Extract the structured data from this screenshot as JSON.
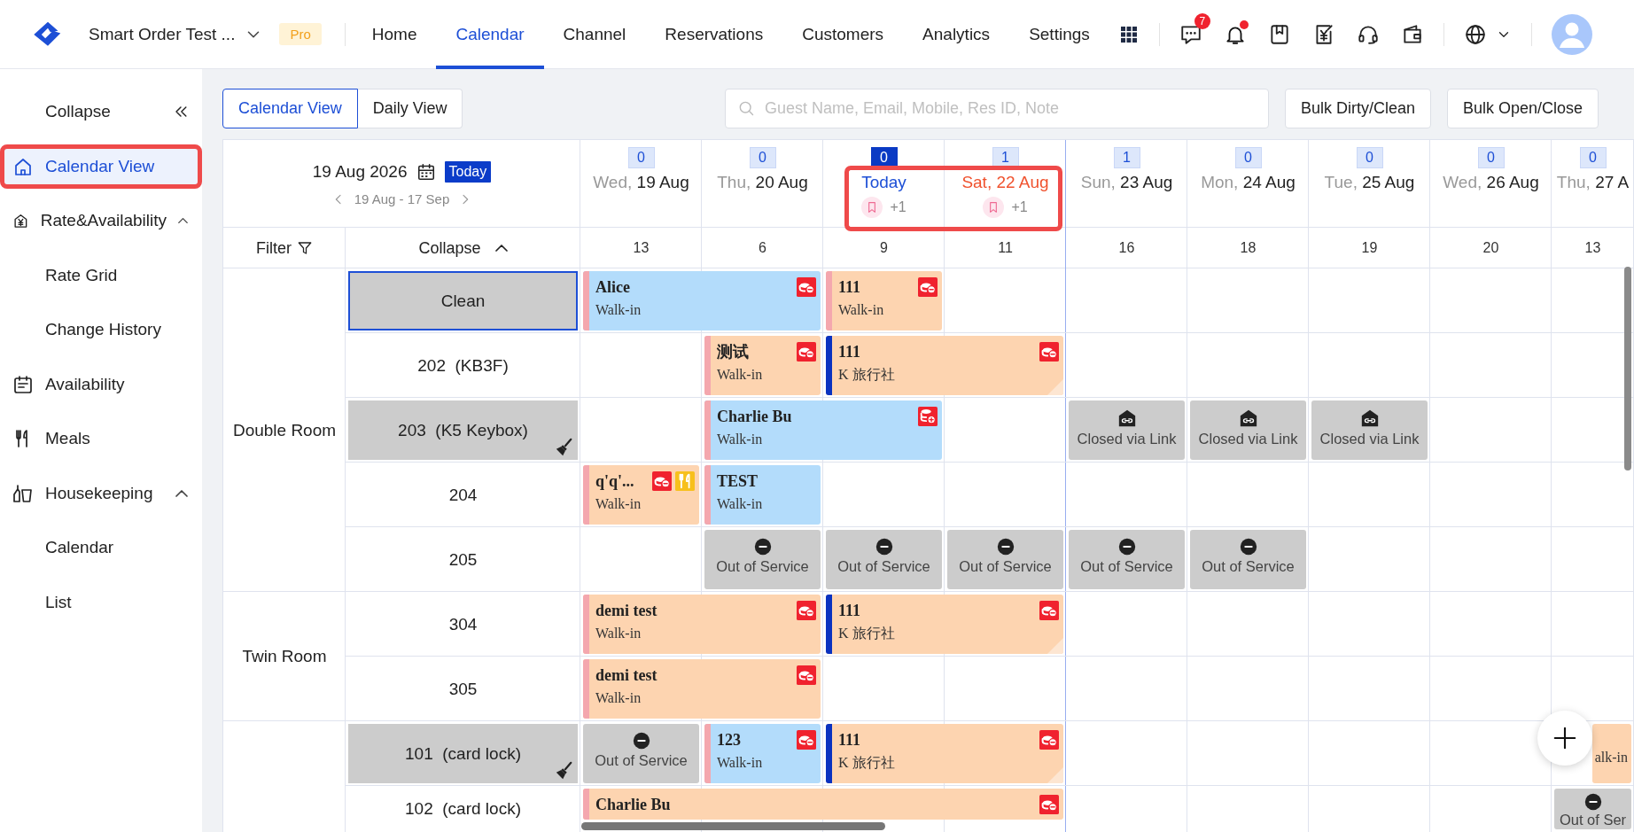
{
  "header": {
    "workspace": "Smart Order Test ...",
    "plan": "Pro",
    "nav": [
      {
        "label": "Home",
        "selected": false
      },
      {
        "label": "Calendar",
        "selected": true
      },
      {
        "label": "Channel",
        "selected": false
      },
      {
        "label": "Reservations",
        "selected": false
      },
      {
        "label": "Customers",
        "selected": false
      },
      {
        "label": "Analytics",
        "selected": false
      },
      {
        "label": "Settings",
        "selected": false
      }
    ],
    "tools": [
      {
        "badge": "7",
        "dot": false
      },
      {
        "dot": true
      },
      {
        "dot": false
      },
      {
        "dot": false
      },
      {
        "dot": false
      },
      {
        "dot": false
      }
    ]
  },
  "sidebar": {
    "collapse": "Collapse",
    "items": [
      {
        "label": "Calendar View",
        "selected": true,
        "highlighted": true
      },
      {
        "label": "Rate&Availability",
        "selected": false,
        "highlighted": false,
        "expanded": true,
        "children": [
          {
            "label": "Rate Grid",
            "selected": false
          },
          {
            "label": "Change History",
            "selected": false
          }
        ]
      },
      {
        "label": "Availability",
        "selected": false,
        "highlighted": false
      },
      {
        "label": "Meals",
        "selected": false,
        "highlighted": false
      },
      {
        "label": "Housekeeping",
        "selected": false,
        "highlighted": false,
        "expanded": true,
        "children": [
          {
            "label": "Calendar",
            "selected": false
          },
          {
            "label": "List",
            "selected": false
          }
        ]
      }
    ]
  },
  "toolbar": {
    "views": [
      {
        "label": "Calendar View",
        "selected": true
      },
      {
        "label": "Daily View",
        "selected": false
      }
    ],
    "search": {
      "placeholder": "Guest Name, Email, Mobile, Res ID, Note"
    },
    "buttons": [
      "Bulk Dirty/Clean",
      "Bulk Open/Close"
    ]
  },
  "calendar": {
    "current_date": "19 Aug 2026",
    "today_button": "Today",
    "range": "19 Aug - 17 Sep",
    "filter": "Filter",
    "collapse": "Collapse",
    "dates": [
      {
        "kind": "weekday",
        "weekday": "Wed,",
        "date": "19 Aug",
        "count": "0",
        "selected": false,
        "highlighted": false,
        "boundary": false,
        "occupancy": "13"
      },
      {
        "kind": "weekday",
        "weekday": "Thu,",
        "date": "20 Aug",
        "count": "0",
        "selected": false,
        "highlighted": false,
        "boundary": false,
        "occupancy": "6"
      },
      {
        "kind": "today",
        "date": "Today",
        "note": "+1",
        "count": "0",
        "selected": true,
        "highlighted": true,
        "boundary": false,
        "occupancy": "9"
      },
      {
        "kind": "weekend",
        "date": "Sat, 22 Aug",
        "note": "+1",
        "count": "1",
        "selected": false,
        "highlighted": true,
        "boundary": true,
        "occupancy": "11"
      },
      {
        "kind": "weekday",
        "weekday": "Sun,",
        "date": "23 Aug",
        "count": "1",
        "selected": false,
        "highlighted": false,
        "boundary": false,
        "occupancy": "16"
      },
      {
        "kind": "weekday",
        "weekday": "Mon,",
        "date": "24 Aug",
        "count": "0",
        "selected": false,
        "highlighted": false,
        "boundary": false,
        "occupancy": "18"
      },
      {
        "kind": "weekday",
        "weekday": "Tue,",
        "date": "25 Aug",
        "count": "0",
        "selected": false,
        "highlighted": false,
        "boundary": false,
        "occupancy": "19"
      },
      {
        "kind": "weekday",
        "weekday": "Wed,",
        "date": "26 Aug",
        "count": "0",
        "selected": false,
        "highlighted": false,
        "boundary": false,
        "occupancy": "20"
      },
      {
        "kind": "weekday",
        "weekday": "Thu,",
        "date": "27 A",
        "count": "0",
        "selected": false,
        "highlighted": false,
        "boundary": false,
        "occupancy": "13"
      }
    ],
    "groups": [
      {
        "room_type": "Double Room",
        "rooms": [
          {
            "label": "Clean",
            "dirty": true,
            "selected": true,
            "cells": [
              {
                "kind": "booking",
                "name": "Alice",
                "source": "Walk-in",
                "color": "#b3dcfb",
                "stripe": {
                  "color": "#f4a7ae"
                },
                "icons": [
                  {
                    "kind": "unpaid"
                  }
                ],
                "folded": false
              },
              {
                "kind": "continues"
              },
              {
                "kind": "booking",
                "name": "111",
                "source": "Walk-in",
                "color": "#fdd4b0",
                "stripe": {
                  "color": "#f4a7ae"
                },
                "icons": [
                  {
                    "kind": "unpaid"
                  }
                ],
                "folded": false
              },
              {
                "kind": "empty"
              },
              {
                "kind": "empty"
              },
              {
                "kind": "empty"
              },
              {
                "kind": "empty"
              },
              {
                "kind": "empty"
              },
              {
                "kind": "empty"
              }
            ]
          },
          {
            "label": "202  (KB3F)",
            "dirty": false,
            "selected": false,
            "cells": [
              {
                "kind": "empty"
              },
              {
                "kind": "booking",
                "name": "测试",
                "source": "Walk-in",
                "color": "#fdd4b0",
                "stripe": {
                  "color": "#f4a7ae"
                },
                "icons": [
                  {
                    "kind": "unpaid"
                  }
                ],
                "folded": false
              },
              {
                "kind": "booking",
                "name": "111",
                "source": "K 旅行社",
                "color": "#fdd4b0",
                "stripe": {
                  "color": "#0a32c0"
                },
                "icons": [
                  {
                    "kind": "unpaid"
                  }
                ],
                "folded": true
              },
              {
                "kind": "continues"
              },
              {
                "kind": "empty"
              },
              {
                "kind": "empty"
              },
              {
                "kind": "empty"
              },
              {
                "kind": "empty"
              },
              {
                "kind": "empty"
              }
            ]
          },
          {
            "label": "203  (K5 Keybox)",
            "dirty": true,
            "selected": false,
            "cells": [
              {
                "kind": "empty"
              },
              {
                "kind": "booking",
                "name": "Charlie Bu",
                "source": "Walk-in",
                "color": "#b3dcfb",
                "stripe": {
                  "color": "#f4a7ae"
                },
                "icons": [
                  {
                    "kind": "deposit"
                  }
                ],
                "folded": false
              },
              {
                "kind": "continues"
              },
              {
                "kind": "empty"
              },
              {
                "kind": "closed-link",
                "label": "Closed via Link"
              },
              {
                "kind": "closed-link",
                "label": "Closed via Link"
              },
              {
                "kind": "closed-link",
                "label": "Closed via Link"
              },
              {
                "kind": "empty"
              },
              {
                "kind": "empty"
              }
            ]
          },
          {
            "label": "204",
            "dirty": false,
            "selected": false,
            "cells": [
              {
                "kind": "booking",
                "name": "q'q'...",
                "source": "Walk-in",
                "color": "#fdd4b0",
                "stripe": {
                  "color": "#f4a7ae"
                },
                "icons": [
                  {
                    "kind": "unpaid"
                  },
                  {
                    "kind": "meal"
                  }
                ],
                "folded": false
              },
              {
                "kind": "booking",
                "name": "TEST",
                "source": "Walk-in",
                "color": "#b3dcfb",
                "stripe": {
                  "color": "#f4a7ae"
                },
                "folded": false
              },
              {
                "kind": "empty"
              },
              {
                "kind": "empty"
              },
              {
                "kind": "empty"
              },
              {
                "kind": "empty"
              },
              {
                "kind": "empty"
              },
              {
                "kind": "empty"
              },
              {
                "kind": "empty"
              }
            ]
          },
          {
            "label": "205",
            "dirty": false,
            "selected": false,
            "cells": [
              {
                "kind": "empty"
              },
              {
                "kind": "out-of-service",
                "label": "Out of Service"
              },
              {
                "kind": "out-of-service",
                "label": "Out of Service"
              },
              {
                "kind": "out-of-service",
                "label": "Out of Service"
              },
              {
                "kind": "out-of-service",
                "label": "Out of Service"
              },
              {
                "kind": "out-of-service",
                "label": "Out of Service"
              },
              {
                "kind": "empty"
              },
              {
                "kind": "empty"
              },
              {
                "kind": "empty"
              }
            ]
          }
        ]
      },
      {
        "room_type": "Twin Room",
        "rooms": [
          {
            "label": "304",
            "dirty": false,
            "selected": false,
            "cells": [
              {
                "kind": "booking",
                "name": "demi test",
                "source": "Walk-in",
                "color": "#fdd4b0",
                "stripe": {
                  "color": "#f4a7ae"
                },
                "icons": [
                  {
                    "kind": "unpaid"
                  }
                ],
                "folded": false
              },
              {
                "kind": "continues"
              },
              {
                "kind": "booking",
                "name": "111",
                "source": "K 旅行社",
                "color": "#fdd4b0",
                "stripe": {
                  "color": "#0a32c0"
                },
                "icons": [
                  {
                    "kind": "unpaid"
                  }
                ],
                "folded": true
              },
              {
                "kind": "continues"
              },
              {
                "kind": "empty"
              },
              {
                "kind": "empty"
              },
              {
                "kind": "empty"
              },
              {
                "kind": "empty"
              },
              {
                "kind": "empty"
              }
            ]
          },
          {
            "label": "305",
            "dirty": false,
            "selected": false,
            "cells": [
              {
                "kind": "booking",
                "name": "demi test",
                "source": "Walk-in",
                "color": "#fdd4b0",
                "stripe": {
                  "color": "#f4a7ae"
                },
                "icons": [
                  {
                    "kind": "unpaid"
                  }
                ],
                "folded": false
              },
              {
                "kind": "continues"
              },
              {
                "kind": "empty"
              },
              {
                "kind": "empty"
              },
              {
                "kind": "empty"
              },
              {
                "kind": "empty"
              },
              {
                "kind": "empty"
              },
              {
                "kind": "empty"
              },
              {
                "kind": "empty"
              }
            ]
          }
        ]
      },
      {
        "rooms": [
          {
            "label": "101  (card lock)",
            "dirty": true,
            "selected": false,
            "cells": [
              {
                "kind": "out-of-service",
                "label": "Out of Service"
              },
              {
                "kind": "booking",
                "name": "123",
                "source": "Walk-in",
                "color": "#b3dcfb",
                "stripe": {
                  "color": "#f4a7ae"
                },
                "icons": [
                  {
                    "kind": "unpaid"
                  }
                ],
                "folded": false
              },
              {
                "kind": "booking",
                "name": "111",
                "source": "K 旅行社",
                "color": "#fdd4b0",
                "stripe": {
                  "color": "#0a32c0"
                },
                "icons": [
                  {
                    "kind": "unpaid"
                  }
                ],
                "folded": true
              },
              {
                "kind": "continues"
              },
              {
                "kind": "empty"
              },
              {
                "kind": "empty"
              },
              {
                "kind": "empty"
              },
              {
                "kind": "empty"
              },
              {
                "kind": "booking",
                "source": "alk-in",
                "color": "#fdd4b0"
              }
            ]
          },
          {
            "label": "102  (card lock)",
            "dirty": false,
            "selected": false,
            "cells": [
              {
                "kind": "booking",
                "name": "Charlie Bu",
                "color": "#fdd4b0",
                "stripe": {
                  "color": "#f4a7ae"
                },
                "icons": [
                  {
                    "kind": "unpaid"
                  }
                ]
              },
              {
                "kind": "continues"
              },
              {
                "kind": "continues"
              },
              {
                "kind": "continues"
              },
              {
                "kind": "empty"
              },
              {
                "kind": "empty"
              },
              {
                "kind": "empty"
              },
              {
                "kind": "empty"
              },
              {
                "kind": "out-of-service",
                "label": "Out of Ser"
              }
            ]
          }
        ]
      }
    ]
  }
}
